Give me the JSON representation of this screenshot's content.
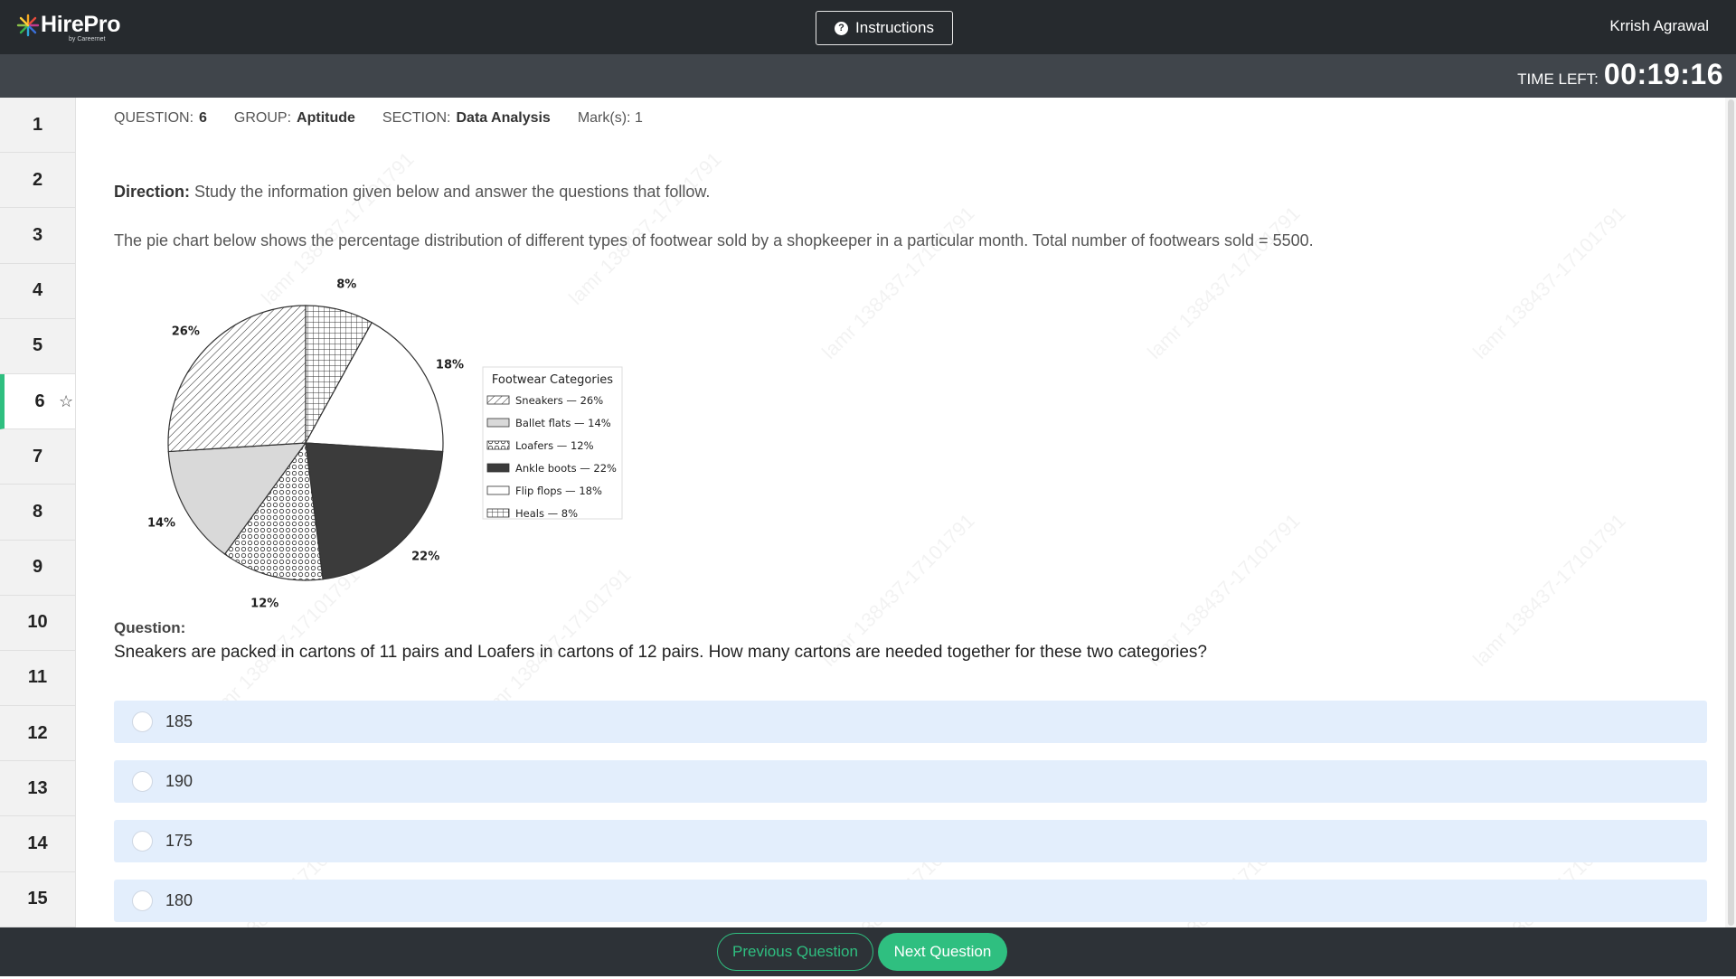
{
  "header": {
    "logo_text": "HirePro",
    "logo_sub": "by Careernet",
    "instructions_label": "Instructions",
    "user_name": "Krrish Agrawal"
  },
  "timer": {
    "label": "TIME LEFT:",
    "value": "00:19:16"
  },
  "sidebar": {
    "items": [
      "1",
      "2",
      "3",
      "4",
      "5",
      "6",
      "7",
      "8",
      "9",
      "10",
      "11",
      "12",
      "13",
      "14",
      "15"
    ],
    "active_index": 5
  },
  "meta": {
    "question_label": "QUESTION:",
    "question_value": "6",
    "group_label": "GROUP:",
    "group_value": "Aptitude",
    "section_label": "SECTION:",
    "section_value": "Data Analysis",
    "marks_label": "Mark(s):",
    "marks_value": "1"
  },
  "direction": {
    "label": "Direction:",
    "text": "Study the information given below and answer the questions that follow."
  },
  "description": "The pie chart below shows the percentage distribution of different types of footwear sold by a shopkeeper in a particular month. Total number of footwears sold = 5500.",
  "question": {
    "label": "Question:",
    "text": "Sneakers are packed in cartons of 11 pairs and Loafers in cartons of 12 pairs. How many cartons are needed together for these two categories?"
  },
  "options": [
    "185",
    "190",
    "175",
    "180"
  ],
  "footer": {
    "prev_label": "Previous Question",
    "next_label": "Next Question"
  },
  "watermark": "lamr 138437-17101791",
  "chart_data": {
    "type": "pie",
    "legend_title": "Footwear Categories",
    "legend_position": "right",
    "slices": [
      {
        "label": "Heals — 8%",
        "value": 8,
        "pattern": "grid"
      },
      {
        "label": "Flip flops — 18%",
        "value": 18,
        "pattern": "white"
      },
      {
        "label": "Ankle boots — 22%",
        "value": 22,
        "pattern": "dark"
      },
      {
        "label": "Loafers — 12%",
        "value": 12,
        "pattern": "circles"
      },
      {
        "label": "Ballet flats — 14%",
        "value": 14,
        "pattern": "lightgray"
      },
      {
        "label": "Sneakers — 26%",
        "value": 26,
        "pattern": "hatch"
      }
    ],
    "value_labels": [
      "8%",
      "18%",
      "22%",
      "12%",
      "14%",
      "26%"
    ],
    "legend_order": [
      5,
      4,
      3,
      2,
      1,
      0
    ]
  }
}
